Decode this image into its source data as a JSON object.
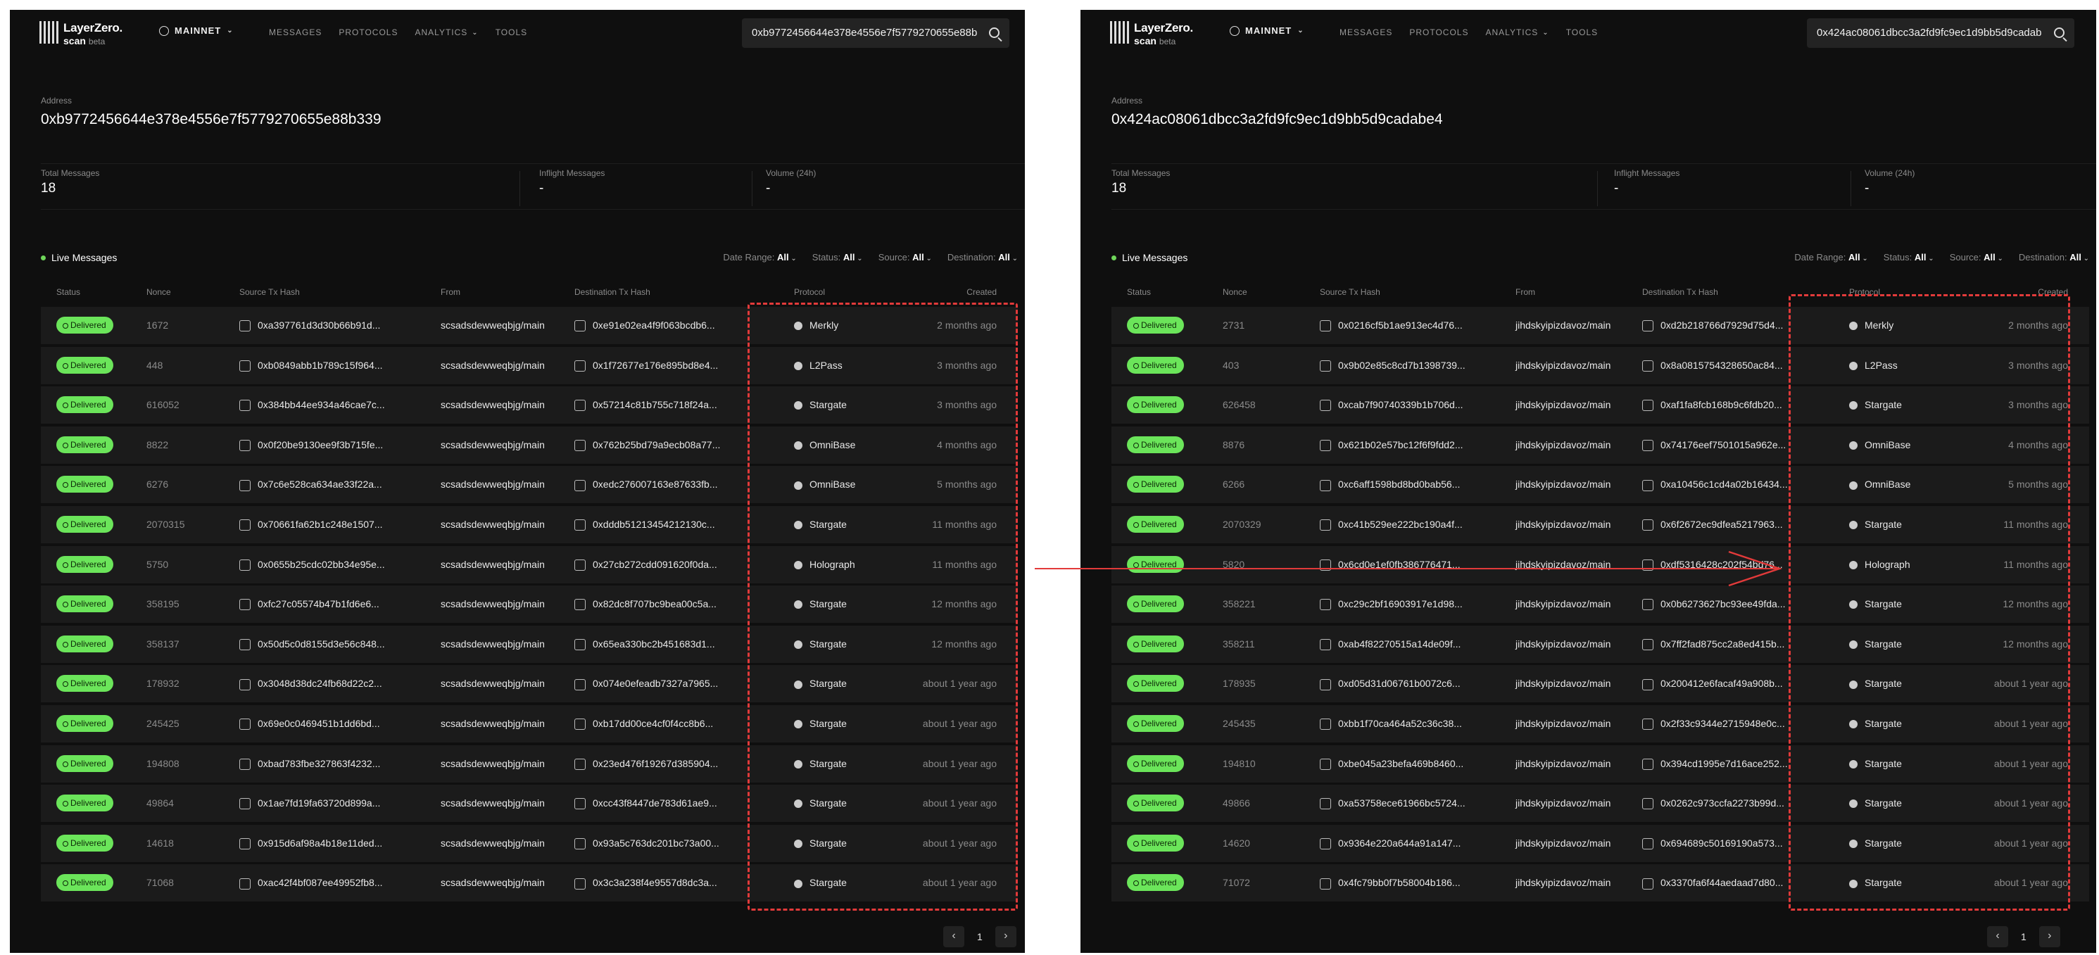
{
  "brand": {
    "name": "LayerZero.",
    "sub": "scan",
    "tag": "beta"
  },
  "network": "MAINNET",
  "nav": [
    "MESSAGES",
    "PROTOCOLS",
    "ANALYTICS",
    "TOOLS"
  ],
  "labels": {
    "address": "Address",
    "total": "Total Messages",
    "inflight": "Inflight Messages",
    "volume": "Volume (24h)",
    "live": "Live Messages"
  },
  "filters": [
    {
      "label": "Date Range:",
      "value": "All"
    },
    {
      "label": "Status:",
      "value": "All"
    },
    {
      "label": "Source:",
      "value": "All"
    },
    {
      "label": "Destination:",
      "value": "All"
    }
  ],
  "columns": [
    "Status",
    "Nonce",
    "Source Tx Hash",
    "From",
    "Destination Tx Hash",
    "Protocol",
    "Created"
  ],
  "status_label": "Delivered",
  "page": "1",
  "colors": {
    "bg": "#0f0f0f",
    "delivered": "#6be55a",
    "annotation": "#e23a3a"
  },
  "left": {
    "search": "0xb9772456644e378e4556e7f5779270655e88b",
    "address": "0xb9772456644e378e4556e7f5779270655e88b339",
    "total": "18",
    "inflight": "-",
    "volume": "-",
    "rows": [
      {
        "nonce": "1672",
        "src": "0xa397761d3d30b66b91d...",
        "from": "scsadsdewweqbjg/main",
        "dst": "0xe91e02ea4f9f063bcdb6...",
        "proto": "Merkly",
        "created": "2 months ago"
      },
      {
        "nonce": "448",
        "src": "0xb0849abb1b789c15f964...",
        "from": "scsadsdewweqbjg/main",
        "dst": "0x1f72677e176e895bd8e4...",
        "proto": "L2Pass",
        "created": "3 months ago"
      },
      {
        "nonce": "616052",
        "src": "0x384bb44ee934a46cae7c...",
        "from": "scsadsdewweqbjg/main",
        "dst": "0x57214c81b755c718f24a...",
        "proto": "Stargate",
        "created": "3 months ago"
      },
      {
        "nonce": "8822",
        "src": "0x0f20be9130ee9f3b715fe...",
        "from": "scsadsdewweqbjg/main",
        "dst": "0x762b25bd79a9ecb08a77...",
        "proto": "OmniBase",
        "created": "4 months ago"
      },
      {
        "nonce": "6276",
        "src": "0x7c6e528ca634ae33f22a...",
        "from": "scsadsdewweqbjg/main",
        "dst": "0xedc276007163e87633fb...",
        "proto": "OmniBase",
        "created": "5 months ago"
      },
      {
        "nonce": "2070315",
        "src": "0x70661fa62b1c248e1507...",
        "from": "scsadsdewweqbjg/main",
        "dst": "0xdddb51213454212130c...",
        "proto": "Stargate",
        "created": "11 months ago"
      },
      {
        "nonce": "5750",
        "src": "0x0655b25cdc02bb34e95e...",
        "from": "scsadsdewweqbjg/main",
        "dst": "0x27cb272cdd091620f0da...",
        "proto": "Holograph",
        "created": "11 months ago"
      },
      {
        "nonce": "358195",
        "src": "0xfc27c05574b47b1fd6e6...",
        "from": "scsadsdewweqbjg/main",
        "dst": "0x82dc8f707bc9bea00c5a...",
        "proto": "Stargate",
        "created": "12 months ago"
      },
      {
        "nonce": "358137",
        "src": "0x50d5c0d8155d3e56c848...",
        "from": "scsadsdewweqbjg/main",
        "dst": "0x65ea330bc2b451683d1...",
        "proto": "Stargate",
        "created": "12 months ago"
      },
      {
        "nonce": "178932",
        "src": "0x3048d38dc24fb68d22c2...",
        "from": "scsadsdewweqbjg/main",
        "dst": "0x074e0efeadb7327a7965...",
        "proto": "Stargate",
        "created": "about 1 year ago"
      },
      {
        "nonce": "245425",
        "src": "0x69e0c0469451b1dd6bd...",
        "from": "scsadsdewweqbjg/main",
        "dst": "0xb17dd00ce4cf0f4cc8b6...",
        "proto": "Stargate",
        "created": "about 1 year ago"
      },
      {
        "nonce": "194808",
        "src": "0xbad783fbe327863f4232...",
        "from": "scsadsdewweqbjg/main",
        "dst": "0x23ed476f19267d385904...",
        "proto": "Stargate",
        "created": "about 1 year ago"
      },
      {
        "nonce": "49864",
        "src": "0x1ae7fd19fa63720d899a...",
        "from": "scsadsdewweqbjg/main",
        "dst": "0xcc43f8447de783d61ae9...",
        "proto": "Stargate",
        "created": "about 1 year ago"
      },
      {
        "nonce": "14618",
        "src": "0x915d6af98a4b18e11ded...",
        "from": "scsadsdewweqbjg/main",
        "dst": "0x93a5c763dc201bc73a00...",
        "proto": "Stargate",
        "created": "about 1 year ago"
      },
      {
        "nonce": "71068",
        "src": "0xac42f4bf087ee49952fb8...",
        "from": "scsadsdewweqbjg/main",
        "dst": "0x3c3a238f4e9557d8dc3a...",
        "proto": "Stargate",
        "created": "about 1 year ago"
      }
    ]
  },
  "right": {
    "search": "0x424ac08061dbcc3a2fd9fc9ec1d9bb5d9cadab",
    "address": "0x424ac08061dbcc3a2fd9fc9ec1d9bb5d9cadabe4",
    "total": "18",
    "inflight": "-",
    "volume": "-",
    "rows": [
      {
        "nonce": "2731",
        "src": "0x0216cf5b1ae913ec4d76...",
        "from": "jihdskyipizdavoz/main",
        "dst": "0xd2b218766d7929d75d4...",
        "proto": "Merkly",
        "created": "2 months ago"
      },
      {
        "nonce": "403",
        "src": "0x9b02e85c8cd7b1398739...",
        "from": "jihdskyipizdavoz/main",
        "dst": "0x8a0815754328650ac84...",
        "proto": "L2Pass",
        "created": "3 months ago"
      },
      {
        "nonce": "626458",
        "src": "0xcab7f90740339b1b706d...",
        "from": "jihdskyipizdavoz/main",
        "dst": "0xaf1fa8fcb168b9c6fdb20...",
        "proto": "Stargate",
        "created": "3 months ago"
      },
      {
        "nonce": "8876",
        "src": "0x621b02e57bc12f6f9fdd2...",
        "from": "jihdskyipizdavoz/main",
        "dst": "0x74176eef7501015a962e...",
        "proto": "OmniBase",
        "created": "4 months ago"
      },
      {
        "nonce": "6266",
        "src": "0xc6aff1598bd8bd0bab56...",
        "from": "jihdskyipizdavoz/main",
        "dst": "0xa10456c1cd4a02b16434...",
        "proto": "OmniBase",
        "created": "5 months ago"
      },
      {
        "nonce": "2070329",
        "src": "0xc41b529ee222bc190a4f...",
        "from": "jihdskyipizdavoz/main",
        "dst": "0x6f2672ec9dfea5217963...",
        "proto": "Stargate",
        "created": "11 months ago"
      },
      {
        "nonce": "5820",
        "src": "0x6cd0e1ef0fb386776471...",
        "from": "jihdskyipizdavoz/main",
        "dst": "0xdf5316428c202f54bd76...",
        "proto": "Holograph",
        "created": "11 months ago"
      },
      {
        "nonce": "358221",
        "src": "0xc29c2bf16903917e1d98...",
        "from": "jihdskyipizdavoz/main",
        "dst": "0x0b6273627bc93ee49fda...",
        "proto": "Stargate",
        "created": "12 months ago"
      },
      {
        "nonce": "358211",
        "src": "0xab4f82270515a14de09f...",
        "from": "jihdskyipizdavoz/main",
        "dst": "0x7ff2fad875cc2a8ed415b...",
        "proto": "Stargate",
        "created": "12 months ago"
      },
      {
        "nonce": "178935",
        "src": "0xd05d31d06761b0072c6...",
        "from": "jihdskyipizdavoz/main",
        "dst": "0x200412e6facaf49a908b...",
        "proto": "Stargate",
        "created": "about 1 year ago"
      },
      {
        "nonce": "245435",
        "src": "0xbb1f70ca464a52c36c38...",
        "from": "jihdskyipizdavoz/main",
        "dst": "0x2f33c9344e2715948e0c...",
        "proto": "Stargate",
        "created": "about 1 year ago"
      },
      {
        "nonce": "194810",
        "src": "0xbe045a23befa469b8460...",
        "from": "jihdskyipizdavoz/main",
        "dst": "0x394cd1995e7d16ace252...",
        "proto": "Stargate",
        "created": "about 1 year ago"
      },
      {
        "nonce": "49866",
        "src": "0xa53758ece61966bc5724...",
        "from": "jihdskyipizdavoz/main",
        "dst": "0x0262c973ccfa2273b99d...",
        "proto": "Stargate",
        "created": "about 1 year ago"
      },
      {
        "nonce": "14620",
        "src": "0x9364e220a644a91a147...",
        "from": "jihdskyipizdavoz/main",
        "dst": "0x694689c50169190a573...",
        "proto": "Stargate",
        "created": "about 1 year ago"
      },
      {
        "nonce": "71072",
        "src": "0x4fc79bb0f7b58004b186...",
        "from": "jihdskyipizdavoz/main",
        "dst": "0x3370fa6f44aedaad7d80...",
        "proto": "Stargate",
        "created": "about 1 year ago"
      }
    ]
  }
}
